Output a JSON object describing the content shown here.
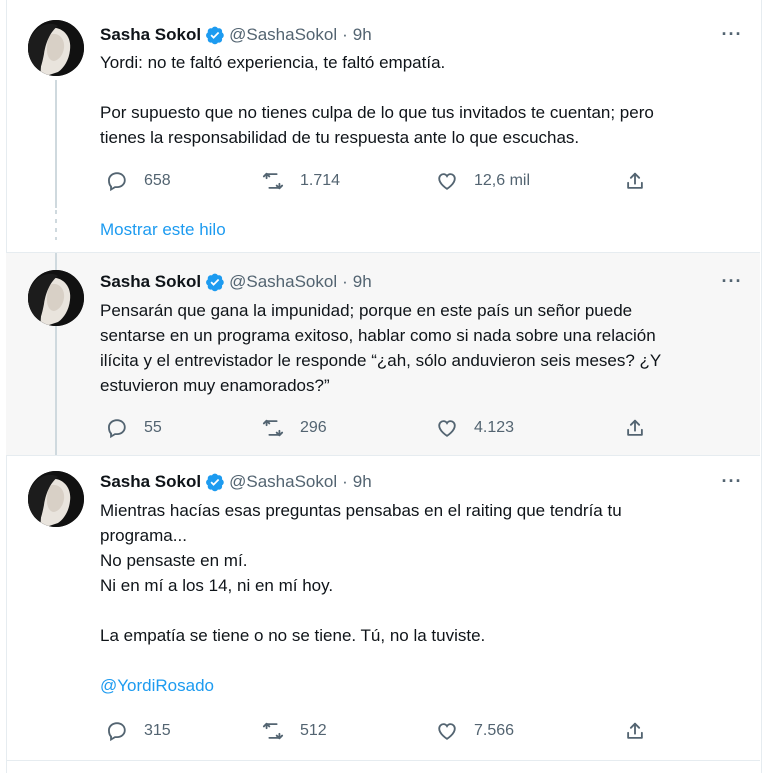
{
  "colors": {
    "accent": "#1d9bf0",
    "text": "#0f1419",
    "muted": "#536471",
    "highlight_bg": "#f7f7f7"
  },
  "tweets": [
    {
      "name": "Sasha Sokol",
      "handle": "@SashaSokol",
      "sep": "·",
      "time": "9h",
      "more": "···",
      "lines": [
        "Yordi: no te faltó experiencia, te faltó empatía.",
        "",
        "Por supuesto que no tienes culpa de lo que tus invitados te cuentan; pero",
        "tienes la responsabilidad de tu respuesta ante lo que escuchas."
      ],
      "replies": "658",
      "retweets": "1.714",
      "likes": "12,6 mil",
      "thread_link": "Mostrar este hilo"
    },
    {
      "name": "Sasha Sokol",
      "handle": "@SashaSokol",
      "sep": "·",
      "time": "9h",
      "more": "···",
      "lines": [
        "Pensarán que gana la impunidad; porque en este país un señor puede",
        "sentarse en un programa exitoso, hablar como si nada sobre una relación",
        "ilícita y el entrevistador le responde “¿ah, sólo anduvieron seis meses? ¿Y",
        "estuvieron muy enamorados?”"
      ],
      "replies": "55",
      "retweets": "296",
      "likes": "4.123"
    },
    {
      "name": "Sasha Sokol",
      "handle": "@SashaSokol",
      "sep": "·",
      "time": "9h",
      "more": "···",
      "lines": [
        "Mientras hacías esas preguntas pensabas en el raiting que tendría tu",
        "programa...",
        "No pensaste en mí.",
        "Ni en mí a los 14, ni en mí hoy.",
        "",
        "La empatía se tiene o no se tiene. Tú, no la tuviste.",
        ""
      ],
      "mention": "@YordiRosado",
      "replies": "315",
      "retweets": "512",
      "likes": "7.566"
    }
  ]
}
